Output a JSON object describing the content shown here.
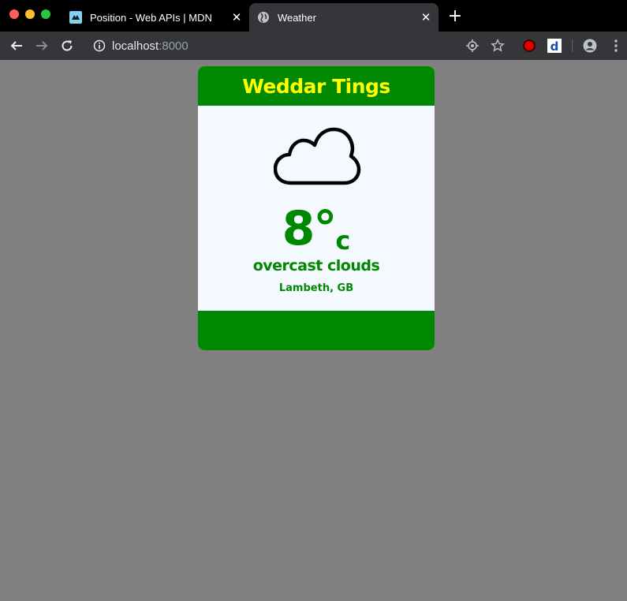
{
  "browser": {
    "tabs": [
      {
        "title": "Position - Web APIs | MDN",
        "icon": "mdn-favicon-icon"
      },
      {
        "title": "Weather",
        "icon": "globe-icon",
        "active": true
      }
    ],
    "url": {
      "host": "localhost",
      "port": ":8000"
    }
  },
  "weather": {
    "title": "Weddar Tings",
    "temperature": "8°",
    "unit": "c",
    "description": "overcast clouds",
    "location": "Lambeth, GB",
    "icon": "cloud-icon"
  },
  "colors": {
    "header_green": "#008800",
    "title_yellow": "#ffff00",
    "card_background": "#f4f8ff",
    "page_background": "#808080"
  }
}
